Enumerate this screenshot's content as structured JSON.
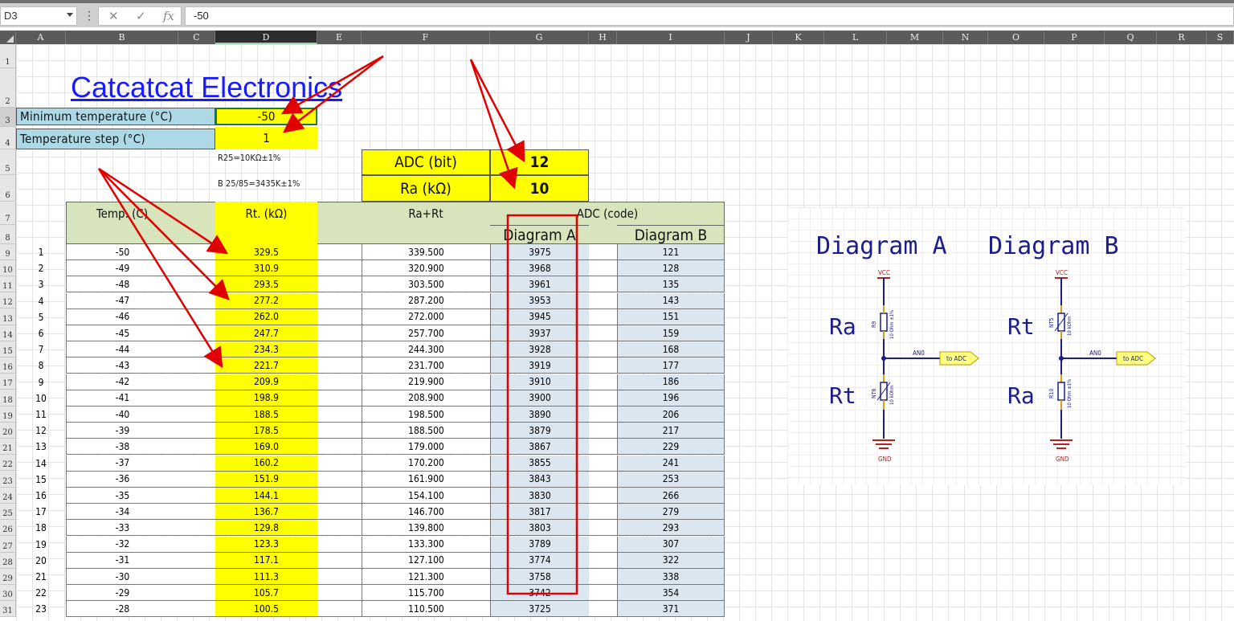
{
  "formula_bar": {
    "name_box": "D3",
    "fx": "fx",
    "value": "-50"
  },
  "columns": [
    "A",
    "B",
    "C",
    "D",
    "E",
    "F",
    "G",
    "H",
    "I",
    "J",
    "K",
    "L",
    "M",
    "N",
    "O",
    "P",
    "Q",
    "R",
    "S"
  ],
  "rows": [
    "1",
    "2",
    "3",
    "4",
    "5",
    "6",
    "7",
    "8",
    "9",
    "10",
    "11",
    "12",
    "13",
    "14",
    "15",
    "16",
    "17",
    "18",
    "19",
    "20",
    "21",
    "22",
    "23",
    "24",
    "25",
    "26",
    "27",
    "28",
    "29",
    "30",
    "31"
  ],
  "sheet": {
    "title": "Catcatcat Electronics",
    "min_temp_label": "Minimum temperature  (°C)",
    "min_temp_value": "-50",
    "temp_step_label": "Temperature step (°C)",
    "temp_step_value": "1",
    "note_r25": "R25=10KΩ±1%",
    "note_b": "B 25/85=3435K±1%",
    "adc_bit_label": "ADC (bit)",
    "adc_bit_value": "12",
    "ra_label": "Ra (kΩ)",
    "ra_value": "10"
  },
  "table": {
    "headers": {
      "temp": "Temp. (C)",
      "rt": "Rt. (kΩ)",
      "ra_rt": "Ra+Rt",
      "adc": "ADC (code)",
      "diag_a": "Diagram A",
      "diag_b": "Diagram B"
    },
    "rows": [
      [
        "1",
        "-50",
        "329.5",
        "339.500",
        "3975",
        "121"
      ],
      [
        "2",
        "-49",
        "310.9",
        "320.900",
        "3968",
        "128"
      ],
      [
        "3",
        "-48",
        "293.5",
        "303.500",
        "3961",
        "135"
      ],
      [
        "4",
        "-47",
        "277.2",
        "287.200",
        "3953",
        "143"
      ],
      [
        "5",
        "-46",
        "262.0",
        "272.000",
        "3945",
        "151"
      ],
      [
        "6",
        "-45",
        "247.7",
        "257.700",
        "3937",
        "159"
      ],
      [
        "7",
        "-44",
        "234.3",
        "244.300",
        "3928",
        "168"
      ],
      [
        "8",
        "-43",
        "221.7",
        "231.700",
        "3919",
        "177"
      ],
      [
        "9",
        "-42",
        "209.9",
        "219.900",
        "3910",
        "186"
      ],
      [
        "10",
        "-41",
        "198.9",
        "208.900",
        "3900",
        "196"
      ],
      [
        "11",
        "-40",
        "188.5",
        "198.500",
        "3890",
        "206"
      ],
      [
        "12",
        "-39",
        "178.5",
        "188.500",
        "3879",
        "217"
      ],
      [
        "13",
        "-38",
        "169.0",
        "179.000",
        "3867",
        "229"
      ],
      [
        "14",
        "-37",
        "160.2",
        "170.200",
        "3855",
        "241"
      ],
      [
        "15",
        "-36",
        "151.9",
        "161.900",
        "3843",
        "253"
      ],
      [
        "16",
        "-35",
        "144.1",
        "154.100",
        "3830",
        "266"
      ],
      [
        "17",
        "-34",
        "136.7",
        "146.700",
        "3817",
        "279"
      ],
      [
        "18",
        "-33",
        "129.8",
        "139.800",
        "3803",
        "293"
      ],
      [
        "19",
        "-32",
        "123.3",
        "133.300",
        "3789",
        "307"
      ],
      [
        "20",
        "-31",
        "117.1",
        "127.100",
        "3774",
        "322"
      ],
      [
        "21",
        "-30",
        "111.3",
        "121.300",
        "3758",
        "338"
      ],
      [
        "22",
        "-29",
        "105.7",
        "115.700",
        "3742",
        "354"
      ],
      [
        "23",
        "-28",
        "100.5",
        "110.500",
        "3725",
        "371"
      ]
    ]
  },
  "schematic": {
    "title_a": "Diagram A",
    "title_b": "Diagram B",
    "vcc": "VCC",
    "gnd": "GND",
    "net": "AN0",
    "to_adc": "to ADC",
    "ra": "Ra",
    "rt": "Rt",
    "r9": "R9",
    "r10": "R10",
    "nt5": "NT5",
    "nt6": "NT6",
    "value_10ohm": "10 Ohm ±1%",
    "value_10k": "10 kOhm",
    "colors": {
      "wire": "#1c1c8c",
      "component": "#b22222",
      "label_bg": "#ffff80"
    }
  },
  "annotation_colors": {
    "arrow": "#e00000",
    "highlight_box": "#e00000"
  }
}
